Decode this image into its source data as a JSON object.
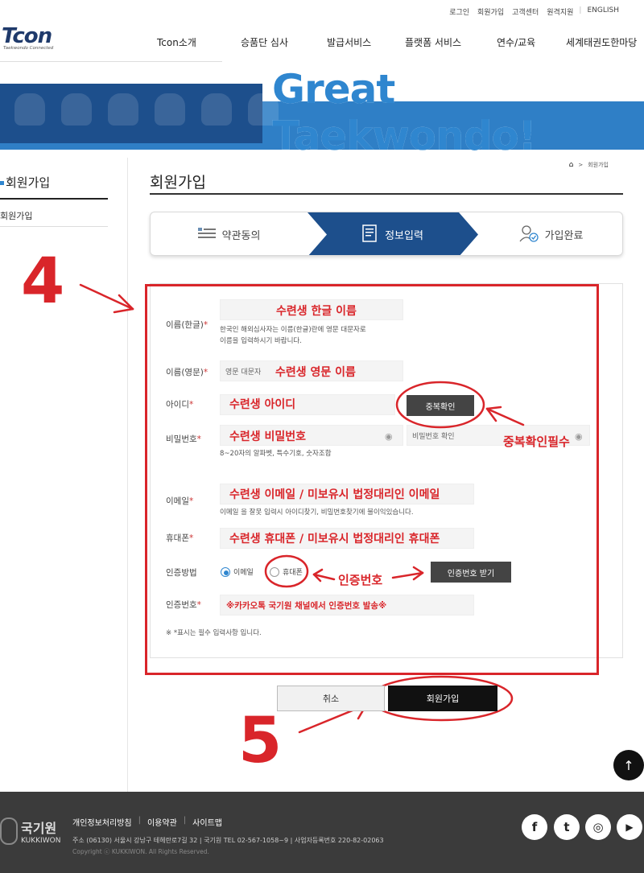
{
  "util_links": [
    "로그인",
    "회원가입",
    "고객센터",
    "원격지원",
    "ENGLISH"
  ],
  "logo": {
    "word": "Tcon",
    "tagline": "Taekwondo Connected"
  },
  "gnb": [
    "Tcon소개",
    "승품단 심사",
    "발급서비스",
    "플랫폼 서비스",
    "연수/교육",
    "세계태권도한마당"
  ],
  "banner": {
    "title": "Great Taekwondo!"
  },
  "lnb": {
    "title": "회원가입",
    "item": "회원가입"
  },
  "breadcrumb": {
    "current": "회원가입"
  },
  "page_title": "회원가입",
  "steps": [
    {
      "label": "약관동의"
    },
    {
      "label": "정보입력"
    },
    {
      "label": "가입완료"
    }
  ],
  "form": {
    "name_kr": {
      "label": "이름(한글)",
      "help1": "한국인 해외심사자는 이름(한글)란에 영문 대문자로",
      "help2": "이름을 입력하시기 바랍니다."
    },
    "name_en": {
      "label": "이름(영문)",
      "placeholder": "영문 대문자"
    },
    "user_id": {
      "label": "아이디",
      "check_button": "중복확인"
    },
    "password": {
      "label": "비밀번호",
      "confirm_placeholder": "비밀번호 확인",
      "help": "8~20자의 알파벳, 특수기호, 숫자조합"
    },
    "email": {
      "label": "이메일",
      "help": "이메일 을 잘못 입력시 아이디찾기, 비밀번호찾기에 불이익있습니다."
    },
    "phone": {
      "label": "휴대폰"
    },
    "auth_method": {
      "label": "인증방법",
      "options": [
        "이메일",
        "휴대폰"
      ],
      "selected": "이메일",
      "button": "인증번호 받기"
    },
    "auth_code": {
      "label": "인증번호"
    },
    "required_note": "※ *표시는 필수 입력사항 입니다.",
    "required_mark": "*"
  },
  "annotations": {
    "step4": "4",
    "step5": "5",
    "name_kr": "수련생 한글 이름",
    "name_en": "수련생 영문 이름",
    "user_id": "수련생 아이디",
    "password": "수련생 비밀번호",
    "dup_required": "중복확인필수",
    "email": "수련생 이메일 / 미보유시 법정대리인 이메일",
    "phone": "수련생 휴대폰 / 미보유시 법정대리인 휴대폰",
    "auth": "인증번호",
    "auth_code": "※카카오톡 국기원 채널에서 인증번호 발송※"
  },
  "buttons": {
    "cancel": "취소",
    "join": "회원가입"
  },
  "footer": {
    "logo_kr": "국기원",
    "logo_en": "KUKKIWON",
    "links": [
      "개인정보처리방침",
      "이용약관",
      "사이트맵"
    ],
    "address": "주소 (06130) 서울시 강남구 테헤란로7길 32 | 국기원 TEL 02-567-1058~9 | 사업자등록번호 220-82-02063",
    "copyright": "Copyright ⓒ KUKKIWON. All Rights Reserved.",
    "sns": [
      "f",
      "t",
      "◎",
      "▶"
    ]
  },
  "colors": {
    "accent": "#2f86cf",
    "step_active": "#1d4f8c",
    "annotation": "#d9252a"
  },
  "icons": {
    "step1": "list-icon",
    "step2": "document-icon",
    "step3": "user-check-icon"
  }
}
